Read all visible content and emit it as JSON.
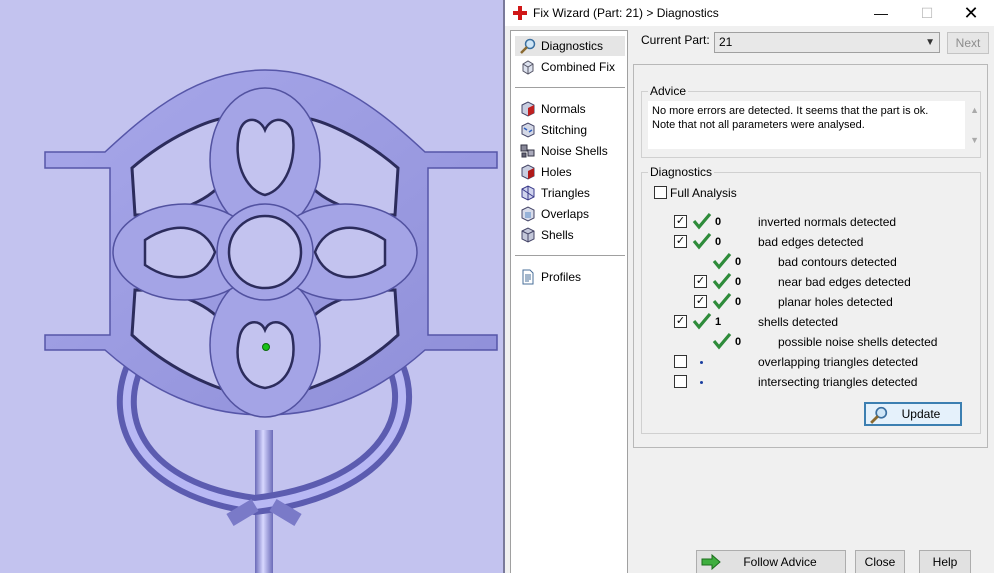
{
  "window": {
    "title": "Fix Wizard (Part: 21) > Diagnostics",
    "min_icon": "minimize-icon",
    "max_icon": "maximize-icon",
    "close_icon": "close-icon"
  },
  "nav": {
    "top": [
      {
        "label": "Diagnostics",
        "icon": "magnifier-icon",
        "selected": true
      },
      {
        "label": "Combined Fix",
        "icon": "cube-icon"
      }
    ],
    "steps": [
      {
        "label": "Normals",
        "icon": "normals-icon"
      },
      {
        "label": "Stitching",
        "icon": "stitching-icon"
      },
      {
        "label": "Noise Shells",
        "icon": "noise-shells-icon"
      },
      {
        "label": "Holes",
        "icon": "holes-icon"
      },
      {
        "label": "Triangles",
        "icon": "triangles-icon"
      },
      {
        "label": "Overlaps",
        "icon": "overlaps-icon"
      },
      {
        "label": "Shells",
        "icon": "shells-icon"
      }
    ],
    "bottom": [
      {
        "label": "Profiles",
        "icon": "document-icon"
      }
    ]
  },
  "current_part": {
    "label": "Current Part:",
    "value": "21",
    "next_label": "Next"
  },
  "advice": {
    "title": "Advice",
    "text_line1": "No more errors are detected. It seems that the part is ok.",
    "text_line2": "Note that not all parameters were analysed."
  },
  "diagnostics": {
    "title": "Diagnostics",
    "full_analysis_label": "Full Analysis",
    "full_analysis_checked": false,
    "rows": [
      {
        "checked": true,
        "status": "ok",
        "count": "0",
        "label": "inverted normals detected"
      },
      {
        "checked": true,
        "status": "ok",
        "count": "0",
        "label": "bad edges detected"
      },
      {
        "checked": null,
        "status": "ok",
        "count": "0",
        "label": "bad contours detected"
      },
      {
        "checked": true,
        "status": "ok",
        "count": "0",
        "label": "near bad edges detected"
      },
      {
        "checked": true,
        "status": "ok",
        "count": "0",
        "label": "planar holes detected"
      },
      {
        "checked": true,
        "status": "ok",
        "count": "1",
        "label": "shells detected"
      },
      {
        "checked": null,
        "status": "ok",
        "count": "0",
        "label": "possible noise shells detected"
      },
      {
        "checked": false,
        "status": "pending",
        "count": "",
        "label": "overlapping triangles detected"
      },
      {
        "checked": false,
        "status": "pending",
        "count": "",
        "label": "intersecting triangles detected"
      }
    ],
    "update_label": "Update"
  },
  "footer": {
    "follow_label": "Follow Advice",
    "close_label": "Close",
    "help_label": "Help"
  },
  "colors": {
    "viewport_bg": "#c3c3ef",
    "part_fill": "#9c9ce0",
    "check_green": "#2e8b3a",
    "accent": "#3c7fb1"
  }
}
